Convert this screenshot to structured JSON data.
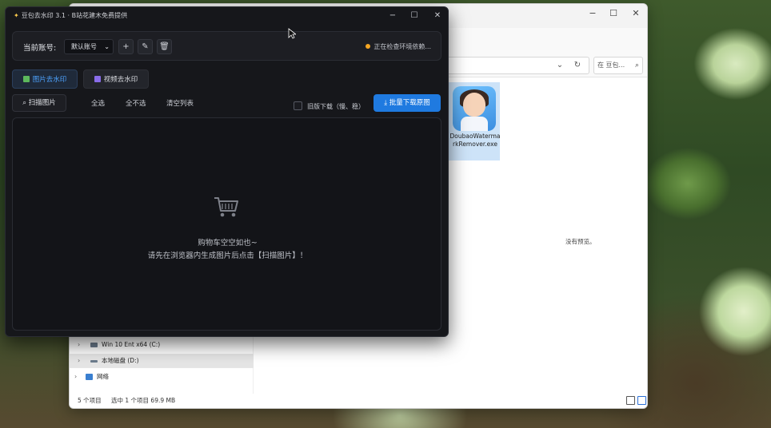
{
  "app": {
    "title": "豆包去水印 3.1 · B站花建木免费提供",
    "controls": {
      "minimize": "−",
      "maximize": "☐",
      "close": "✕"
    },
    "account": {
      "label": "当前账号:",
      "selected": "默认账号",
      "status": "正在检查环境依赖..."
    },
    "tabs": [
      {
        "label": "图片去水印",
        "active": true
      },
      {
        "label": "视频去水印",
        "active": false
      }
    ],
    "toolbar": {
      "scan_label": "扫描图片",
      "select_all": "全选",
      "select_none": "全不选",
      "clear_list": "清空列表",
      "old_download": "旧版下载（慢、稳）",
      "batch_download": "批量下载原图"
    },
    "empty_state": {
      "line1": "购物车空空如也~",
      "line2": "请先在浏览器内生成图片后点击【扫描图片】！"
    },
    "colors": {
      "accent": "#1f7ae0",
      "status_dot": "#f5a623",
      "tab_active": "#4ea3ff"
    }
  },
  "explorer": {
    "search_placeholder": "在 豆包...",
    "nav": [
      {
        "label": "Win 10 Ent x64 (C:)"
      },
      {
        "label": "本地磁盘 (D:)",
        "selected": true
      },
      {
        "label": "网络"
      }
    ],
    "file": {
      "name": "DoubaoWatermarkRemover.exe"
    },
    "preview_text": "没有预览。",
    "status": {
      "count": "5 个项目",
      "selection": "选中 1 个项目  69.9 MB"
    }
  }
}
